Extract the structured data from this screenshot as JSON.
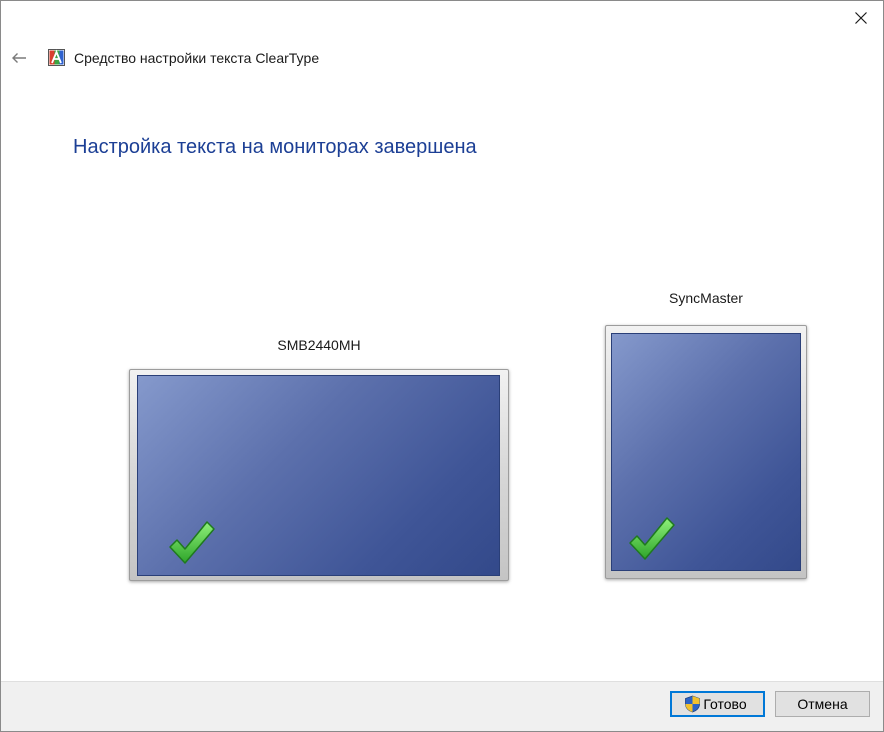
{
  "window": {
    "title": "Средство настройки текста ClearType",
    "heading": "Настройка текста на мониторах завершена"
  },
  "icons": {
    "close": "close-icon",
    "back": "back-arrow-icon",
    "app": "cleartype-app-icon",
    "check": "checkmark-icon",
    "shield": "uac-shield-icon"
  },
  "monitors": [
    {
      "name": "SMB2440MH",
      "status": "configured"
    },
    {
      "name": "SyncMaster",
      "status": "configured"
    }
  ],
  "buttons": {
    "finish": "Готово",
    "cancel": "Отмена"
  },
  "colors": {
    "heading": "#1c3f95",
    "accent": "#0078d7",
    "check": "#3cbf2c"
  }
}
